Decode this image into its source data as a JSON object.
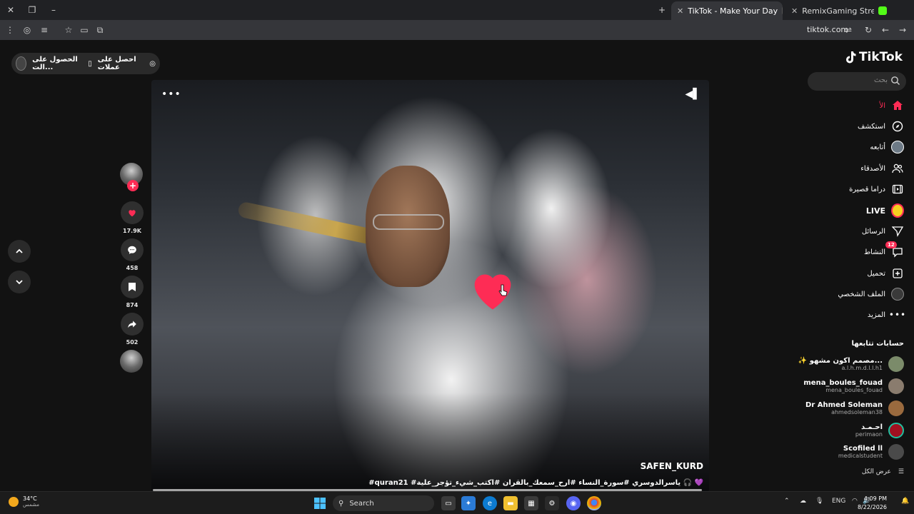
{
  "browser": {
    "tabs": [
      {
        "title": "TikTok - Make Your Day",
        "active": true,
        "favicon_color": "#111111"
      },
      {
        "title": "RemixGaming Stream - Kick De",
        "active": false,
        "favicon_color": "#53fc18"
      }
    ],
    "url": "tiktok.com"
  },
  "promo": {
    "label1": "احصل على عملات",
    "label2": "الحصول على الت..."
  },
  "brand": {
    "logo": "TikTok"
  },
  "search": {
    "placeholder": "بحث"
  },
  "nav": [
    {
      "label": "الأ",
      "icon": "home-icon"
    },
    {
      "label": "استكشف",
      "icon": "compass-icon"
    },
    {
      "label": "أتابعه",
      "icon": "following-avatar-icon"
    },
    {
      "label": "الأصدقاء",
      "icon": "friends-icon"
    },
    {
      "label": "دراما قصيرة",
      "icon": "film-icon"
    },
    {
      "label": "LIVE",
      "icon": "live-icon"
    },
    {
      "label": "الرسائل",
      "icon": "send-icon"
    },
    {
      "label": "النشاط",
      "icon": "inbox-icon",
      "badge": "12"
    },
    {
      "label": "تحميل",
      "icon": "upload-icon"
    },
    {
      "label": "الملف الشخصي",
      "icon": "profile-avatar-icon"
    },
    {
      "label": "المزيد",
      "icon": "more-icon"
    }
  ],
  "following": {
    "title": "حسابات تتابعها",
    "accounts": [
      {
        "name": "✨ مصمم اكون مشهو...",
        "username": "a.l.h.m.d.l.l.h1"
      },
      {
        "name": "mena_boules_fouad",
        "username": "mena_boules_fouad"
      },
      {
        "name": "Dr Ahmed Soleman",
        "username": "ahmedsoleman38"
      },
      {
        "name": "احـمـد",
        "username": "perimaon"
      },
      {
        "name": "Scofiled ll",
        "username": "medicalstudent"
      }
    ],
    "see_all": "عرض الكل"
  },
  "video": {
    "author": "SAFEN_KURD",
    "caption": "#quran21 #ياسرالدوسري #سورة_النساء #ارح_سمعك_بالقران #اكتب_شيء_تؤجر_علية 🎧 💜",
    "progress": 0.99
  },
  "actions": {
    "likes": "17.9K",
    "comments": "458",
    "saves": "874",
    "shares": "502"
  },
  "taskbar": {
    "temperature": "34°C",
    "condition": "مشمس",
    "search_label": "Search",
    "lang": "ENG",
    "time": "4:09 PM",
    "date": "8/22/2026"
  },
  "colors": {
    "accent": "#fe2c55",
    "background": "#121212"
  }
}
